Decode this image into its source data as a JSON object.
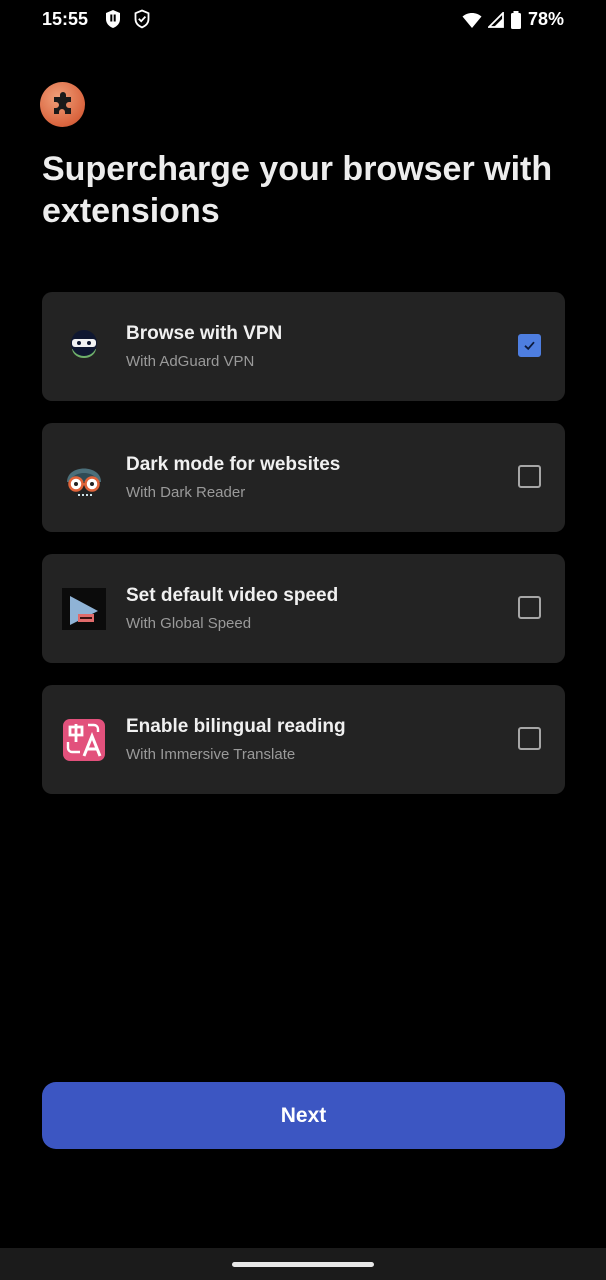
{
  "status_bar": {
    "time": "15:55",
    "battery_percent": "78%",
    "icons": [
      "app-shield-icon",
      "vpn-shield-icon",
      "wifi-icon",
      "signal-icon",
      "battery-icon"
    ]
  },
  "app_logo": {
    "icon": "extension-puzzle-icon",
    "color": "#d9643e"
  },
  "headline": "Supercharge your browser with extensions",
  "extensions": [
    {
      "title": "Browse with VPN",
      "subtitle": "With AdGuard VPN",
      "icon": "adguard-vpn-ninja-icon",
      "checked": true
    },
    {
      "title": "Dark mode for websites",
      "subtitle": "With Dark Reader",
      "icon": "dark-reader-glasses-icon",
      "checked": false
    },
    {
      "title": "Set default video speed",
      "subtitle": "With Global Speed",
      "icon": "global-speed-play-icon",
      "checked": false
    },
    {
      "title": "Enable bilingual reading",
      "subtitle": "With Immersive Translate",
      "icon": "immersive-translate-icon",
      "checked": false
    }
  ],
  "next_button": {
    "label": "Next",
    "color": "#3c56c2"
  },
  "colors": {
    "background": "#000000",
    "card": "#232323",
    "checkbox_checked": "#4e7ee0"
  }
}
